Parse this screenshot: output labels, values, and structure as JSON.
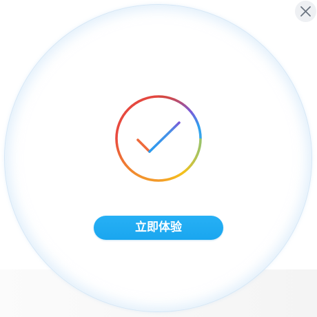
{
  "dialog": {
    "cta_label": "立即体验",
    "close_icon": "close-icon",
    "status_icon": "check-circle-icon"
  },
  "colors": {
    "cta_background": "#1ea9f2",
    "ring_red": "#e84a3f",
    "ring_orange": "#f39a2b",
    "ring_yellow": "#f5c21b",
    "ring_blue": "#2f9ff0",
    "ring_purple": "#7a5ad8",
    "check_blue": "#2a9cf0",
    "check_orange": "#f07a3a",
    "circle_border": "#d6e7f6"
  }
}
